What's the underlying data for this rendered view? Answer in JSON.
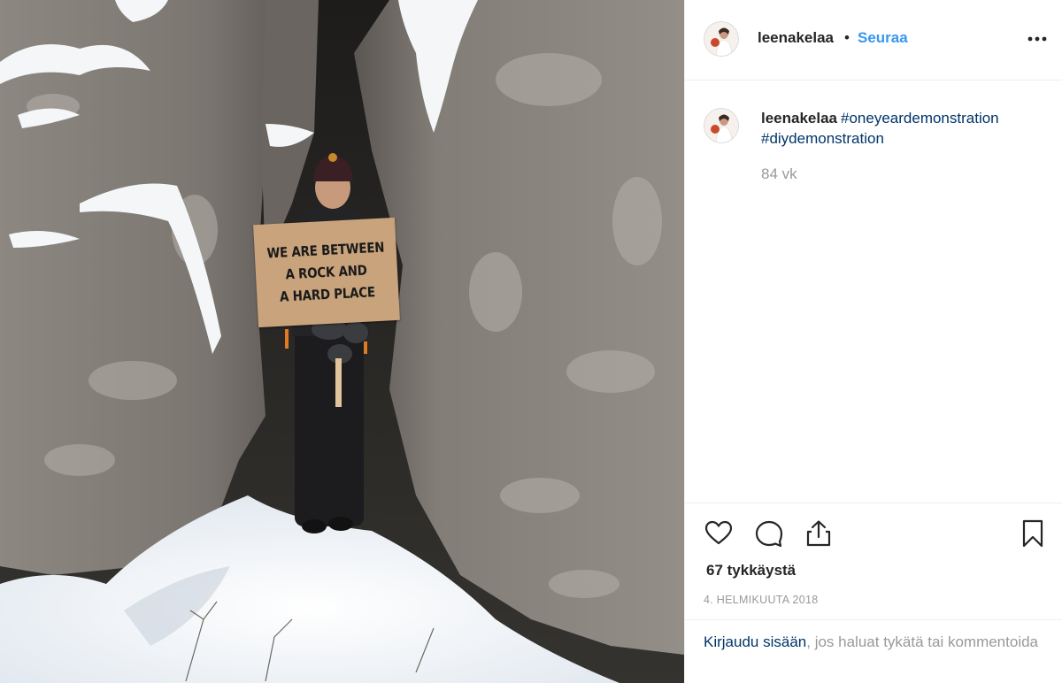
{
  "post": {
    "username": "leenakelaa",
    "dot": "•",
    "follow_label": "Seuraa",
    "more_icon": "more-horizontal-icon"
  },
  "photo": {
    "sign_lines": [
      "WE ARE BETWEEN",
      "A ROCK AND",
      "A HARD PLACE"
    ],
    "colors": {
      "rock": "#807b76",
      "snow": "#f4f6f8",
      "sign": "#c8a37c"
    }
  },
  "caption": {
    "username": "leenakelaa",
    "hashtags": [
      "#oneyeardemonstration",
      "#diydemonstration"
    ],
    "time_ago": "84 vk"
  },
  "actions": {
    "icons": [
      "heart-icon",
      "comment-icon",
      "share-icon",
      "bookmark-icon"
    ],
    "likes": "67 tykkäystä",
    "date": "4. HELMIKUUTA 2018"
  },
  "login": {
    "link_label": "Kirjaudu sisään",
    "rest_text": ", jos haluat tykätä tai kommentoida"
  },
  "colors": {
    "link_blue": "#3897f0",
    "hashtag_blue": "#003569",
    "muted": "#999999",
    "text": "#262626"
  }
}
